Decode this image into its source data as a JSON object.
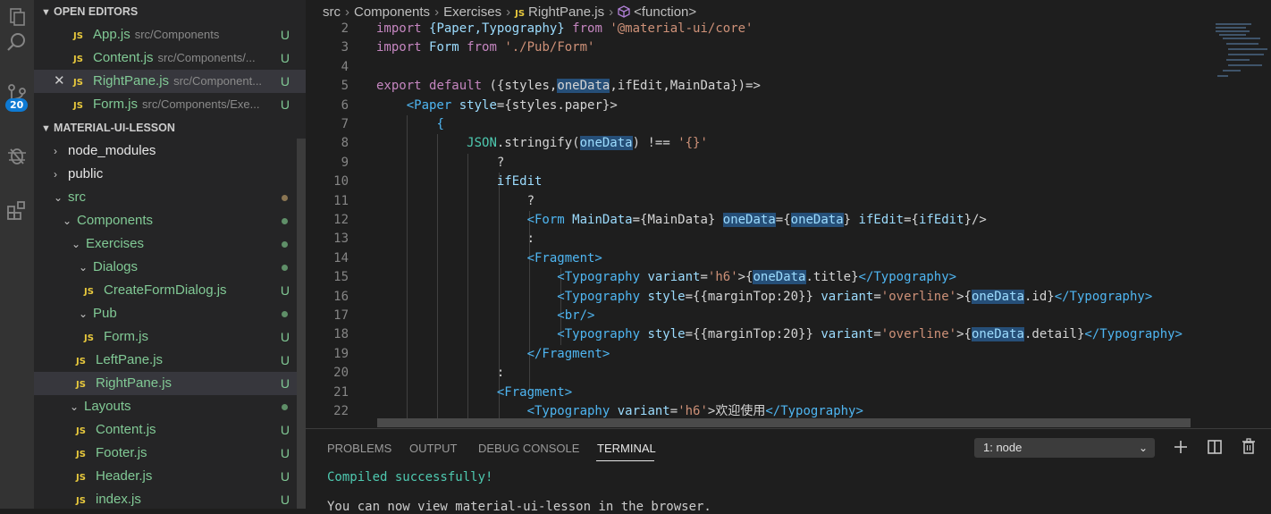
{
  "activity_bar": {
    "scm_badge": "20"
  },
  "open_editors": {
    "header": "OPEN EDITORS",
    "items": [
      {
        "icon": "JS",
        "name": "App.js",
        "path": "src/Components",
        "status": "U"
      },
      {
        "icon": "JS",
        "name": "Content.js",
        "path": "src/Components/...",
        "status": "U"
      },
      {
        "icon": "JS",
        "name": "RightPane.js",
        "path": "src/Component...",
        "status": "U"
      },
      {
        "icon": "JS",
        "name": "Form.js",
        "path": "src/Components/Exe...",
        "status": "U"
      }
    ]
  },
  "explorer": {
    "header": "MATERIAL-UI-LESSON",
    "items": [
      {
        "name": "node_modules"
      },
      {
        "name": "public"
      },
      {
        "name": "src"
      },
      {
        "name": "Components"
      },
      {
        "name": "Exercises"
      },
      {
        "name": "Dialogs"
      },
      {
        "icon": "JS",
        "name": "CreateFormDialog.js",
        "status": "U"
      },
      {
        "name": "Pub"
      },
      {
        "icon": "JS",
        "name": "Form.js",
        "status": "U"
      },
      {
        "icon": "JS",
        "name": "LeftPane.js",
        "status": "U"
      },
      {
        "icon": "JS",
        "name": "RightPane.js",
        "status": "U"
      },
      {
        "name": "Layouts"
      },
      {
        "icon": "JS",
        "name": "Content.js",
        "status": "U"
      },
      {
        "icon": "JS",
        "name": "Footer.js",
        "status": "U"
      },
      {
        "icon": "JS",
        "name": "Header.js",
        "status": "U"
      },
      {
        "icon": "JS",
        "name": "index.js",
        "status": "U"
      }
    ]
  },
  "breadcrumb": {
    "items": [
      "src",
      "Components",
      "Exercises"
    ],
    "file_icon": "JS",
    "file": "RightPane.js",
    "symbol": "<function>"
  },
  "editor": {
    "line_numbers": [
      "2",
      "3",
      "4",
      "5",
      "6",
      "7",
      "8",
      "9",
      "10",
      "11",
      "12",
      "13",
      "14",
      "15",
      "16",
      "17",
      "18",
      "19",
      "20",
      "21",
      "22"
    ],
    "t": {
      "import": "import",
      "from": "from",
      "export": "export",
      "default": "default",
      "paper_typo": "{Paper,Typography}",
      "core_str": "'@material-ui/core'",
      "form_id": "Form",
      "form_str": "'./Pub/Form'",
      "args_open": "({styles,",
      "oneData": "oneData",
      "args_rest": ",ifEdit,MainData})=>",
      "paper_open": "<Paper",
      "style_attr": "style",
      "paper_style_val": "={styles.paper}>",
      "brace_open": "{",
      "json": "JSON",
      "stringify": ".stringify(",
      "neq": ") !== ",
      "empty_obj_str": "'{}'",
      "q": "?",
      "ifEdit": "ifEdit",
      "form_open": "<Form",
      "maindata_attr": "MainData",
      "maindata_val": "={MainData}",
      "onedata_attr": "oneData",
      "eq_brace": "={",
      "close_brace": "}",
      "ifedit_attr": "ifEdit",
      "ifedit_val_open": "={",
      "ifedit_val_close": "}/>",
      "colon": ":",
      "fragment_open": "<Fragment>",
      "typo_open": "<Typography",
      "variant_attr": "variant",
      "eq": "=",
      "h6_str": "'h6'",
      "gt_brace": ">{",
      "title_suffix": ".title}",
      "typo_close": "</Typography>",
      "margin_style": "={{marginTop:20}}",
      "overline_str": "'overline'",
      "id_suffix": ".id}",
      "br": "<br/>",
      "detail_suffix": ".detail}",
      "fragment_close": "</Fragment>",
      "gt": ">",
      "welcome": "欢迎使用"
    }
  },
  "panel": {
    "tabs": [
      "PROBLEMS",
      "OUTPUT",
      "DEBUG CONSOLE",
      "TERMINAL"
    ],
    "terminal_select": "1: node",
    "terminal_lines": [
      "Compiled successfully!",
      "You can now view material-ui-lesson in the browser."
    ]
  }
}
